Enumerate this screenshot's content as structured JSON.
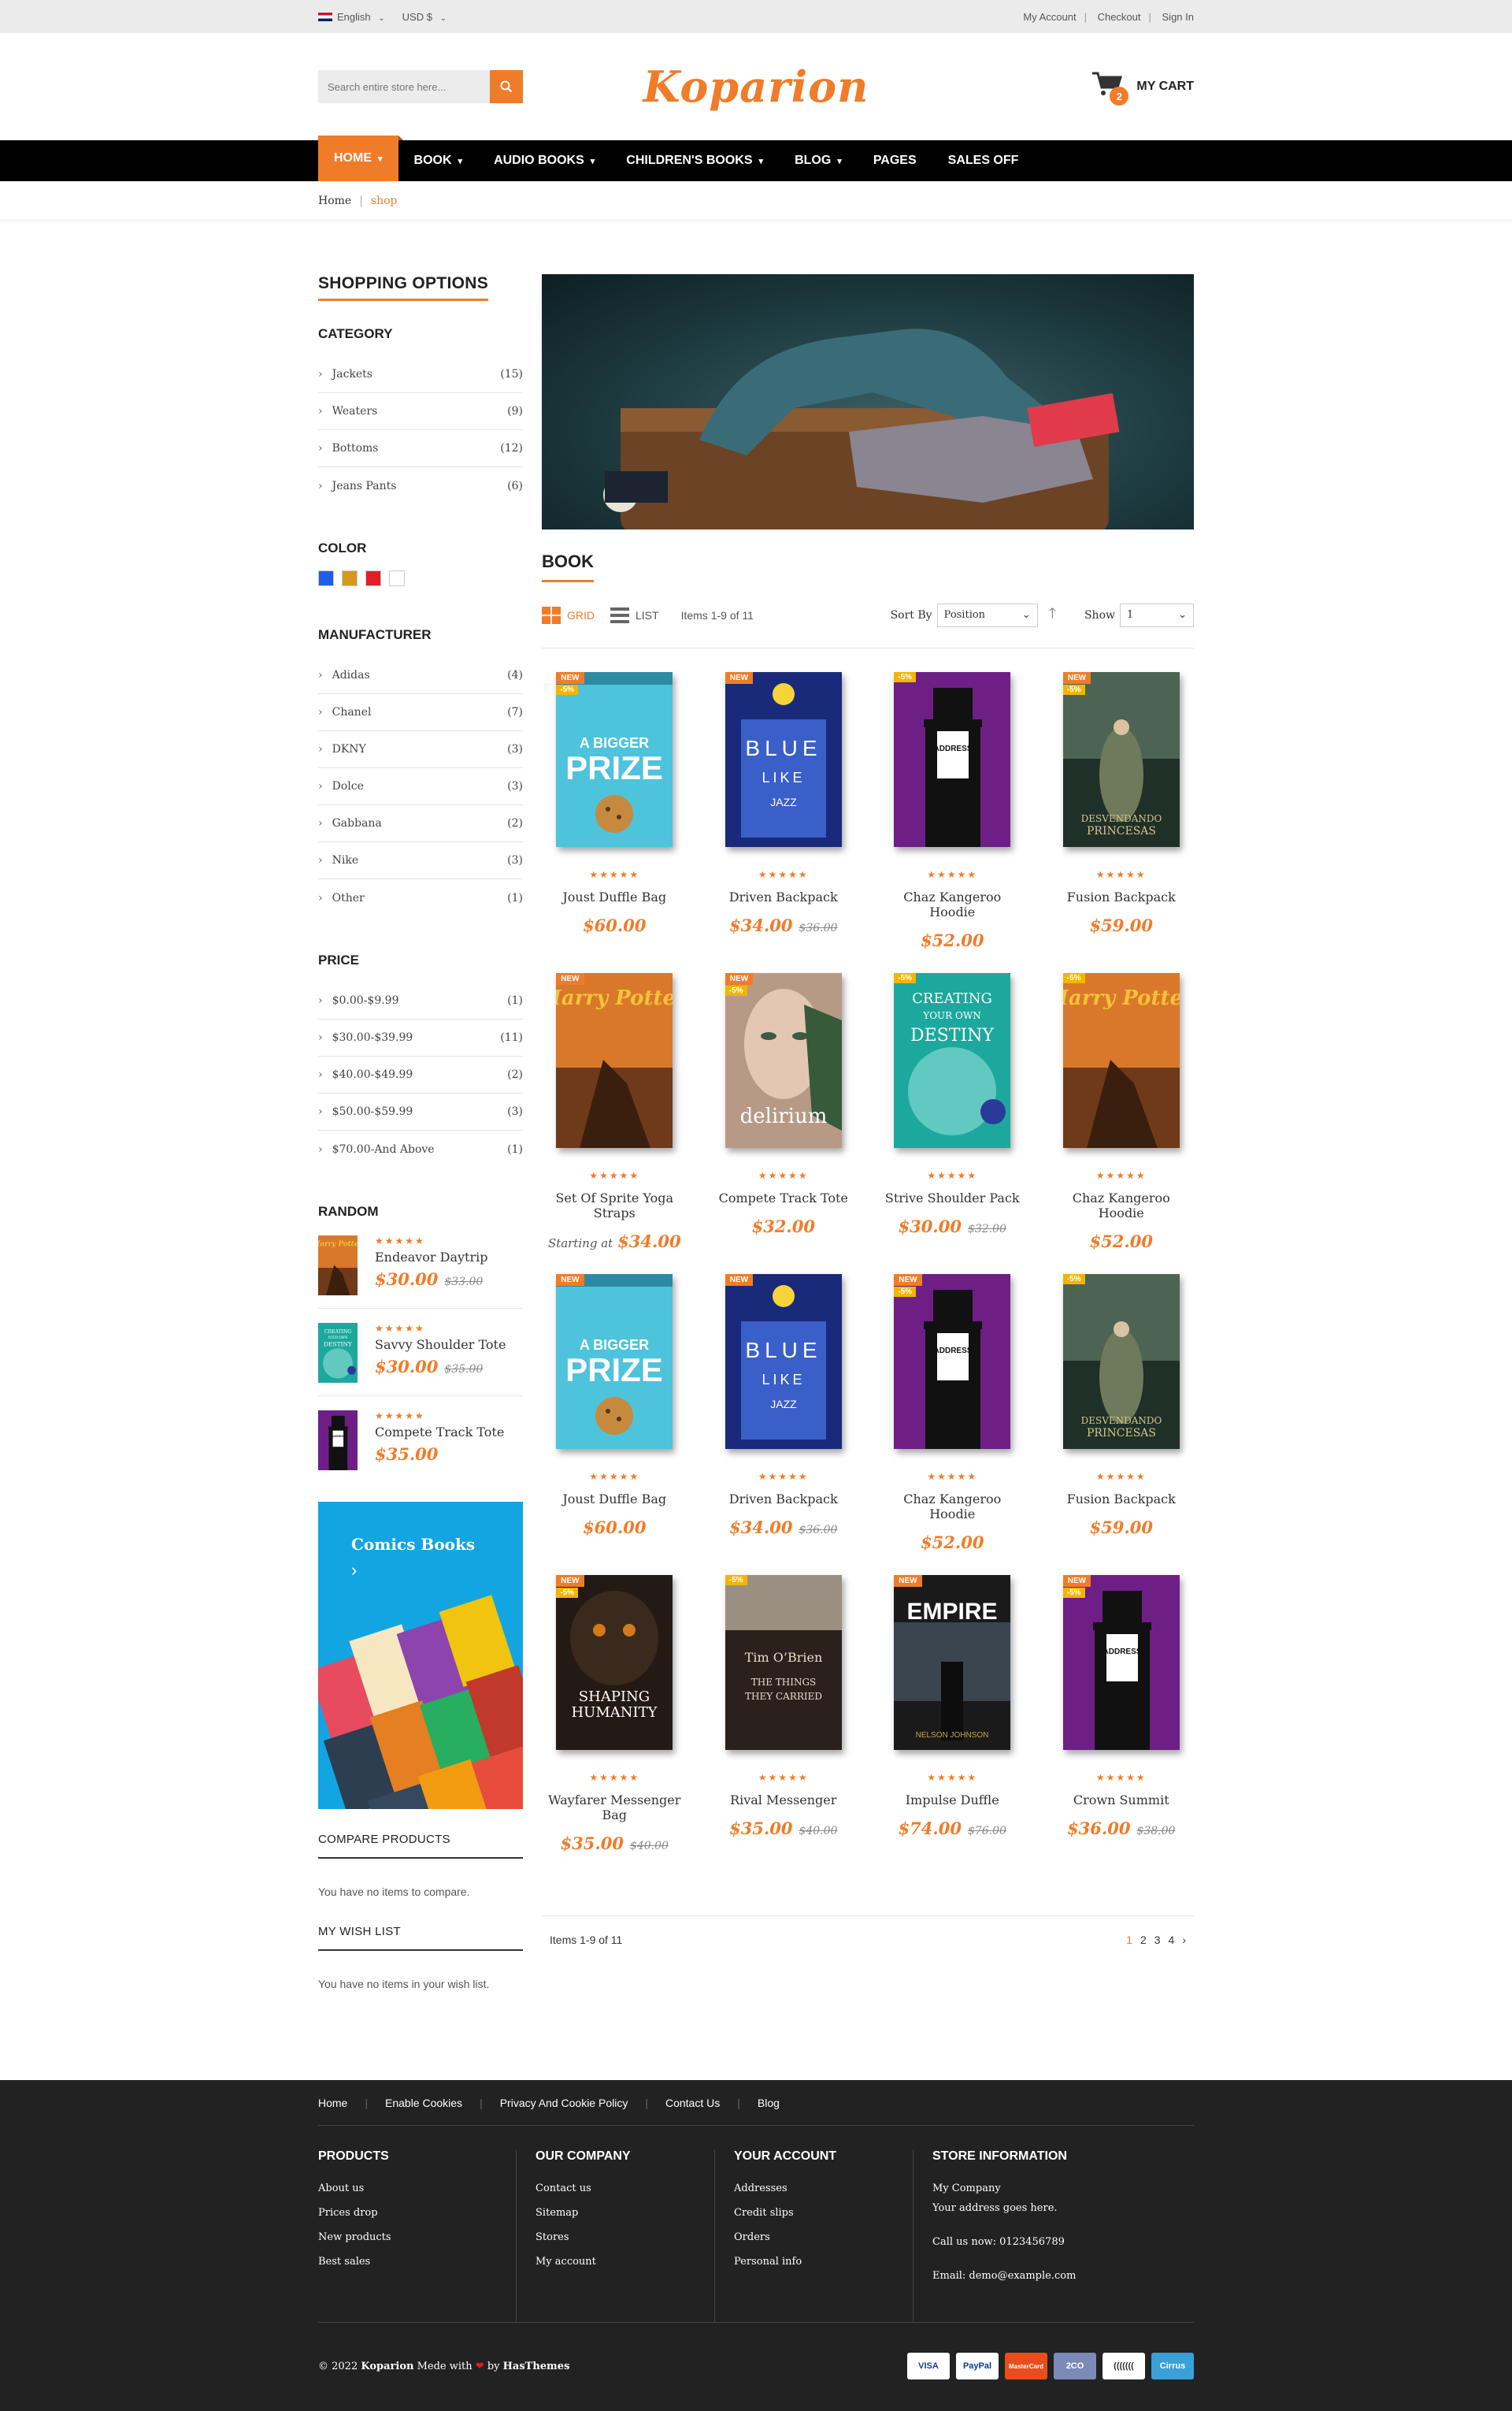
{
  "topbar": {
    "language": "English",
    "currency": "USD $",
    "my_account": "My Account",
    "checkout": "Checkout",
    "sign_in": "Sign In"
  },
  "header": {
    "search_placeholder": "Search entire store here...",
    "logo": "Koparion",
    "cart_label": "MY CART",
    "cart_count": "2"
  },
  "nav": {
    "items": [
      "HOME",
      "BOOK",
      "AUDIO BOOKS",
      "CHILDREN'S BOOKS",
      "BLOG",
      "PAGES",
      "SALES OFF"
    ]
  },
  "breadcrumb": {
    "home": "Home",
    "current": "shop"
  },
  "sidebar": {
    "title": "SHOPPING OPTIONS",
    "category_title": "CATEGORY",
    "categories": [
      {
        "name": "Jackets",
        "count": "(15)"
      },
      {
        "name": "Weaters",
        "count": "(9)"
      },
      {
        "name": "Bottoms",
        "count": "(12)"
      },
      {
        "name": "Jeans Pants",
        "count": "(6)"
      }
    ],
    "color_title": "COLOR",
    "colors": [
      "#1f5fe6",
      "#d39a1d",
      "#e31e24",
      "#ffffff"
    ],
    "manufacturer_title": "MANUFACTURER",
    "manufacturers": [
      {
        "name": "Adidas",
        "count": "(4)"
      },
      {
        "name": "Chanel",
        "count": "(7)"
      },
      {
        "name": "DKNY",
        "count": "(3)"
      },
      {
        "name": "Dolce",
        "count": "(3)"
      },
      {
        "name": "Gabbana",
        "count": "(2)"
      },
      {
        "name": "Nike",
        "count": "(3)"
      },
      {
        "name": "Other",
        "count": "(1)"
      }
    ],
    "price_title": "PRICE",
    "prices": [
      {
        "name": "$0.00-$9.99",
        "count": "(1)"
      },
      {
        "name": "$30.00-$39.99",
        "count": "(11)"
      },
      {
        "name": "$40.00-$49.99",
        "count": "(2)"
      },
      {
        "name": "$50.00-$59.99",
        "count": "(3)"
      },
      {
        "name": "$70.00-And Above",
        "count": "(1)"
      }
    ],
    "random_title": "RANDOM",
    "random": [
      {
        "name": "Endeavor Daytrip",
        "price": "$30.00",
        "old": "$33.00"
      },
      {
        "name": "Savvy Shoulder Tote",
        "price": "$30.00",
        "old": "$35.00"
      },
      {
        "name": "Compete Track Tote",
        "price": "$35.00",
        "old": ""
      }
    ],
    "banner_title": "Comics Books",
    "banner_arrow": "›",
    "compare_title": "COMPARE PRODUCTS",
    "compare_text": "You have no items to compare.",
    "wishlist_title": "MY WISH LIST",
    "wishlist_text": "You have no items in your wish list."
  },
  "content": {
    "section_title": "BOOK",
    "grid_label": "GRID",
    "list_label": "LIST",
    "items_label": "Items 1-9 of 11",
    "sort_label": "Sort By",
    "sort_value": "Position",
    "show_label": "Show",
    "show_value": "1",
    "starting_at": "Starting at",
    "products": [
      {
        "name": "Joust Duffle Bag",
        "price": "$60.00",
        "old": "",
        "new": true,
        "sale": true,
        "cover": "prize"
      },
      {
        "name": "Driven Backpack",
        "price": "$34.00",
        "old": "$36.00",
        "new": true,
        "sale": false,
        "cover": "blue"
      },
      {
        "name": "Chaz Kangeroo Hoodie",
        "price": "$52.00",
        "old": "",
        "new": false,
        "sale": true,
        "cover": "address"
      },
      {
        "name": "Fusion Backpack",
        "price": "$59.00",
        "old": "",
        "new": true,
        "sale": true,
        "cover": "princesas"
      },
      {
        "name": "Set Of Sprite Yoga Straps",
        "price": "$34.00",
        "old": "",
        "new": true,
        "sale": false,
        "cover": "potter",
        "starting": true
      },
      {
        "name": "Compete Track Tote",
        "price": "$32.00",
        "old": "",
        "new": true,
        "sale": true,
        "cover": "delirium"
      },
      {
        "name": "Strive Shoulder Pack",
        "price": "$30.00",
        "old": "$32.00",
        "new": false,
        "sale": true,
        "cover": "destiny"
      },
      {
        "name": "Chaz Kangeroo Hoodie",
        "price": "$52.00",
        "old": "",
        "new": false,
        "sale": true,
        "cover": "potter"
      },
      {
        "name": "Joust Duffle Bag",
        "price": "$60.00",
        "old": "",
        "new": true,
        "sale": false,
        "cover": "prize"
      },
      {
        "name": "Driven Backpack",
        "price": "$34.00",
        "old": "$36.00",
        "new": true,
        "sale": false,
        "cover": "blue"
      },
      {
        "name": "Chaz Kangeroo Hoodie",
        "price": "$52.00",
        "old": "",
        "new": true,
        "sale": true,
        "cover": "address"
      },
      {
        "name": "Fusion Backpack",
        "price": "$59.00",
        "old": "",
        "new": false,
        "sale": true,
        "cover": "princesas"
      },
      {
        "name": "Wayfarer Messenger Bag",
        "price": "$35.00",
        "old": "$40.00",
        "new": true,
        "sale": true,
        "cover": "humanity"
      },
      {
        "name": "Rival Messenger",
        "price": "$35.00",
        "old": "$40.00",
        "new": false,
        "sale": true,
        "cover": "things"
      },
      {
        "name": "Impulse Duffle",
        "price": "$74.00",
        "old": "$76.00",
        "new": true,
        "sale": false,
        "cover": "empire"
      },
      {
        "name": "Crown Summit",
        "price": "$36.00",
        "old": "$38.00",
        "new": true,
        "sale": true,
        "cover": "address"
      }
    ],
    "pager_items": "Items 1-9 of 11",
    "pages": [
      "1",
      "2",
      "3",
      "4",
      "›"
    ]
  },
  "footer": {
    "links": [
      "Home",
      "Enable Cookies",
      "Privacy And Cookie Policy",
      "Contact Us",
      "Blog"
    ],
    "cols": [
      {
        "title": "PRODUCTS",
        "items": [
          "About us",
          "Prices drop",
          "New products",
          "Best sales"
        ]
      },
      {
        "title": "OUR COMPANY",
        "items": [
          "Contact us",
          "Sitemap",
          "Stores",
          "My account"
        ]
      },
      {
        "title": "YOUR ACCOUNT",
        "items": [
          "Addresses",
          "Credit slips",
          "Orders",
          "Personal info"
        ]
      },
      {
        "title": "STORE INFORMATION",
        "items": [
          "My Company",
          "Your address goes here.",
          "Call us now: 0123456789",
          "Email: demo@example.com"
        ]
      }
    ],
    "copyright": "© 2022 ",
    "copyright_brand": "Koparion",
    "copyright_mid": " Mede with ",
    "copyright_by": " by ",
    "copyright_author": "HasThemes",
    "payments": [
      "VISA",
      "PayPal",
      "MasterCard",
      "2CO",
      "(((((((",
      "Cirrus"
    ]
  }
}
